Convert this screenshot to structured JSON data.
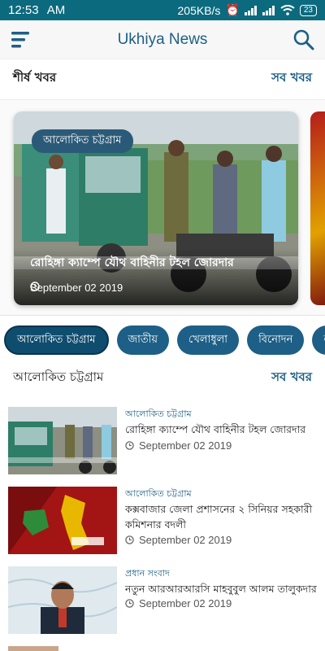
{
  "status_bar": {
    "time": "12:53",
    "ampm": "AM",
    "speed": "205KB/s",
    "battery": "23"
  },
  "app_bar": {
    "title": "Ukhiya News",
    "menu_icon": "menu-icon",
    "search_icon": "search-icon"
  },
  "top_news": {
    "title": "শীর্ষ খবর",
    "see_all": "সব খবর",
    "featured": {
      "category": "আলোকিত চট্টগ্রাম",
      "headline": "রোহিঙ্গা ক্যাম্পে যৌথ বাহিনীর টহল জোরদার",
      "date": "September 02 2019"
    }
  },
  "categories": [
    "আলোকিত চট্টগ্রাম",
    "জাতীয়",
    "খেলাধুলা",
    "বিনোদন",
    "ল"
  ],
  "section": {
    "title": "আলোকিত চট্টগ্রাম",
    "see_all": "সব খবর"
  },
  "list": [
    {
      "category": "আলোকিত চট্টগ্রাম",
      "title": "রোহিঙ্গা ক্যাম্পে যৌথ বাহিনীর টহল জোরদার",
      "date": "September 02 2019"
    },
    {
      "category": "আলোকিত চট্টগ্রাম",
      "title": "কক্সবাজার জেলা প্রশাসনের ২ সিনিয়র সহকারী কমিশনার বদলী",
      "date": "September 02 2019"
    },
    {
      "category": "প্রধান সংবাদ",
      "title": "নতুন আরআরআরসি মাহবুবুল আলম তালুকদার",
      "date": "September 02 2019"
    }
  ],
  "colors": {
    "primary": "#1d5f86",
    "status_bar": "#0c6a7e",
    "chip_active": "#0f4d6e"
  }
}
